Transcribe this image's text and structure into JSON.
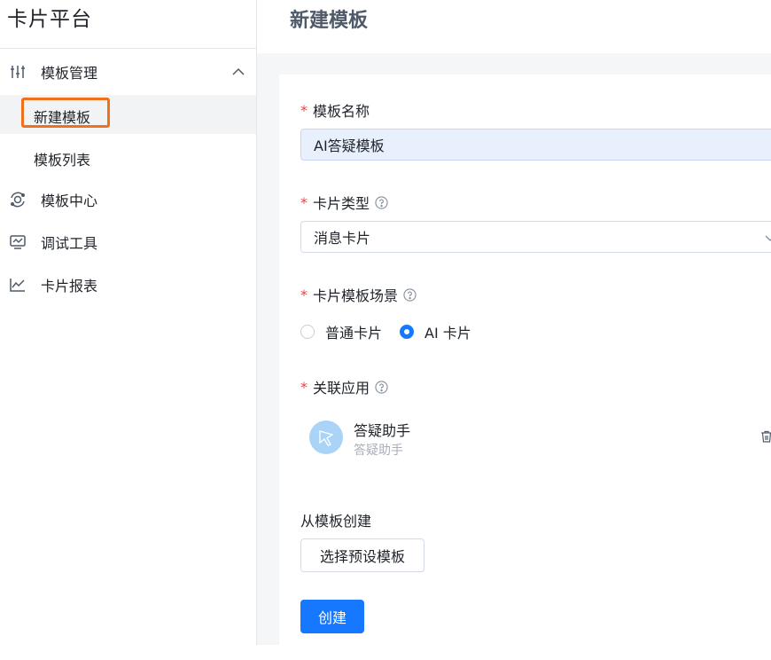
{
  "sidebar": {
    "brand": "卡片平台",
    "menu": [
      {
        "label": "模板管理",
        "icon": "sliders-icon",
        "expanded": true
      },
      {
        "label": "模板中心",
        "icon": "orbit-icon"
      },
      {
        "label": "调试工具",
        "icon": "monitor-icon"
      },
      {
        "label": "卡片报表",
        "icon": "line-chart-icon"
      }
    ],
    "submenu": [
      {
        "label": "新建模板",
        "active": true
      },
      {
        "label": "模板列表",
        "active": false
      }
    ]
  },
  "header": {
    "title": "新建模板"
  },
  "form": {
    "required_mark": "*",
    "template_name": {
      "label": "模板名称",
      "value": "AI答疑模板"
    },
    "card_type": {
      "label": "卡片类型",
      "value": "消息卡片"
    },
    "card_scene": {
      "label": "卡片模板场景",
      "options": [
        {
          "label": "普通卡片",
          "checked": false
        },
        {
          "label": "AI 卡片",
          "checked": true
        }
      ]
    },
    "linked_app": {
      "label": "关联应用",
      "name": "答疑助手",
      "sub": "答疑助手"
    },
    "from_template": {
      "label": "从模板创建",
      "button": "选择预设模板"
    },
    "submit": "创建"
  },
  "colors": {
    "primary": "#1677ff",
    "required": "#f53f3f",
    "highlight": "#f0701c"
  }
}
